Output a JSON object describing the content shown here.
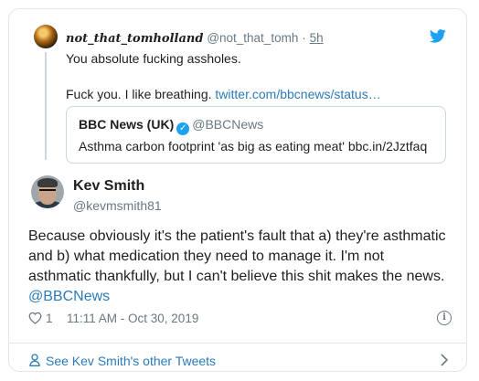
{
  "parent_tweet": {
    "display_name": "not_that_tomholland",
    "handle": "@not_that_tomh",
    "separator": "·",
    "time": "5h",
    "text_line1": "You absolute fucking assholes.",
    "text_line2": "Fuck you. I like breathing.",
    "link": "twitter.com/bbcnews/status…",
    "quoted": {
      "name": "BBC News (UK)",
      "handle": "@BBCNews",
      "text": "Asthma carbon footprint 'as big as eating meat' bbc.in/2Jztfaq"
    }
  },
  "main_tweet": {
    "name": "Kev Smith",
    "handle": "@kevmsmith81",
    "lines": [
      "Because obviously it's the patient's fault that a) they're asthmatic",
      "and b) what medication they need to manage it. I'm not",
      "asthmatic thankfully, but I can't believe this shit makes the news.",
      "@BBCNews"
    ],
    "likes": "1",
    "timestamp": "11:11 AM - Oct 30, 2019"
  },
  "footer": {
    "label": "See Kev Smith's other Tweets"
  },
  "icons": {
    "brand": "twitter-bird-icon",
    "verified": "verified-badge-icon",
    "like": "heart-icon",
    "info": "info-icon",
    "profile": "person-icon",
    "next": "chevron-right-icon"
  },
  "colors": {
    "link": "#2b7bb9",
    "muted": "#697882",
    "brand": "#1da1f2",
    "border": "#e1e8ed"
  }
}
